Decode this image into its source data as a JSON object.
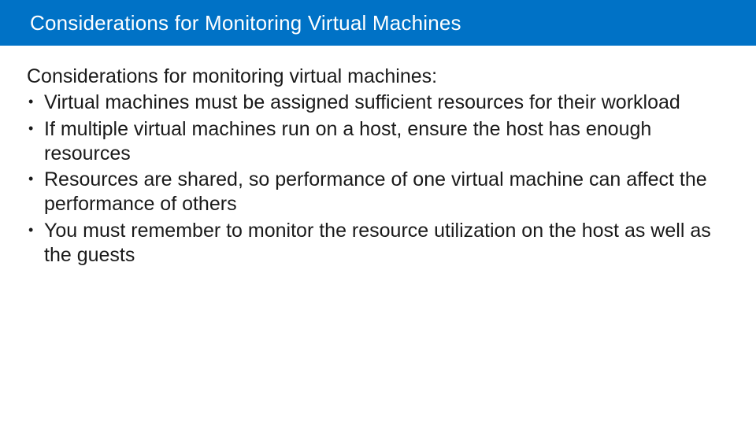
{
  "header": {
    "title": "Considerations for Monitoring Virtual Machines"
  },
  "content": {
    "intro": "Considerations for monitoring virtual machines:",
    "bullets": [
      "Virtual machines must be assigned sufficient resources for their workload",
      "If multiple virtual machines run on a host, ensure the host has enough resources",
      "Resources are shared, so performance of one virtual machine can affect the performance of others",
      "You must remember to monitor the resource utilization on the host as well as the guests"
    ]
  }
}
